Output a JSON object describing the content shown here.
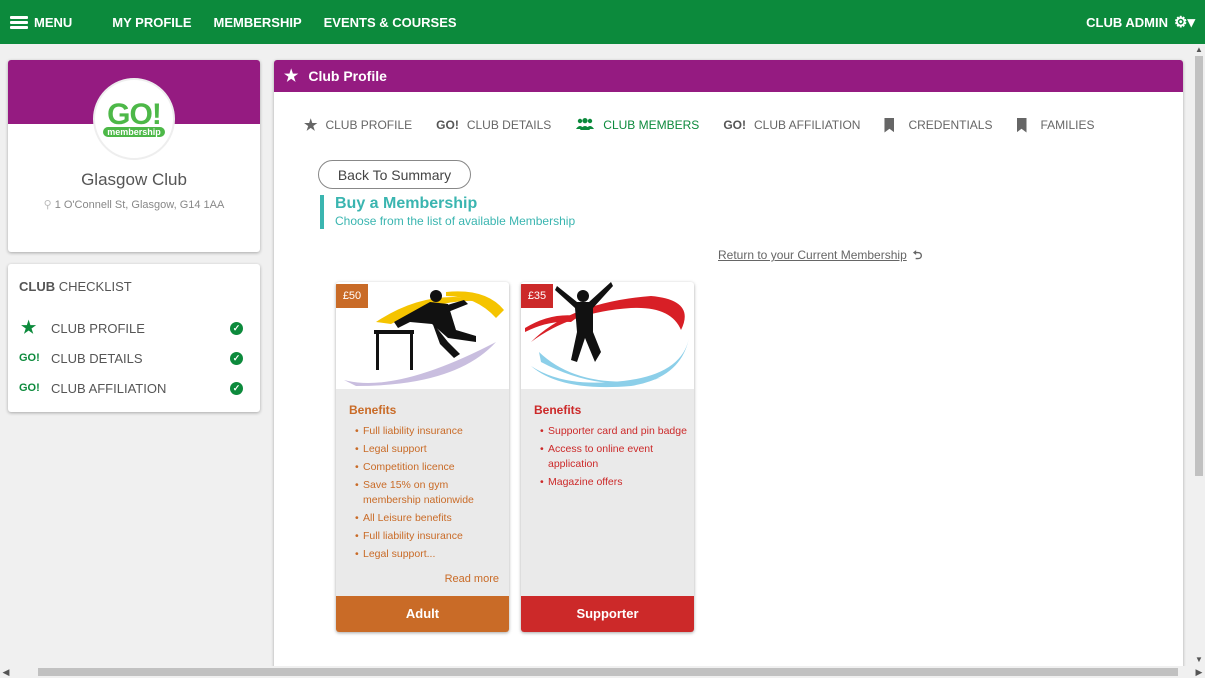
{
  "colors": {
    "brand_green": "#0c8a3c",
    "purple": "#951b81",
    "teal": "#3ab5b0",
    "adult_orange": "#c96b27",
    "supporter_red": "#cc2929"
  },
  "topbar": {
    "menu_label": "MENU",
    "nav": [
      "MY PROFILE",
      "MEMBERSHIP",
      "EVENTS & COURSES"
    ],
    "admin_label": "CLUB ADMIN"
  },
  "club": {
    "logo_text": "GO!",
    "logo_sub": "membership",
    "name": "Glasgow Club",
    "address": "1 O'Connell St, Glasgow, G14 1AA"
  },
  "checklist": {
    "title_bold": "CLUB",
    "title_rest": " CHECKLIST",
    "items": [
      {
        "icon": "star-icon",
        "prefix": "",
        "label": "CLUB PROFILE"
      },
      {
        "icon": "go-icon",
        "prefix": "GO!",
        "label": "CLUB DETAILS"
      },
      {
        "icon": "go-icon",
        "prefix": "GO!",
        "label": "CLUB AFFILIATION"
      }
    ]
  },
  "panel": {
    "title": "Club Profile",
    "tabs": [
      {
        "prefix": "",
        "label": "CLUB PROFILE"
      },
      {
        "prefix": "GO!",
        "label": "CLUB DETAILS"
      },
      {
        "prefix": "",
        "label": "CLUB MEMBERS",
        "active": true
      },
      {
        "prefix": "GO!",
        "label": "CLUB AFFILIATION"
      },
      {
        "prefix": "",
        "label": "CREDENTIALS"
      },
      {
        "prefix": "",
        "label": "FAMILIES"
      }
    ],
    "back_label": "Back To Summary",
    "buy_title": "Buy a Membership",
    "buy_subtitle": "Choose from the list of available Membership",
    "return_label": "Return to your Current Membership"
  },
  "cards": [
    {
      "price": "£50",
      "benefits_title": "Benefits",
      "benefits": [
        "Full liability insurance",
        "Legal support",
        "Competition licence",
        "Save 15% on gym membership nationwide",
        "All Leisure benefits",
        "Full liability insurance",
        "Legal support..."
      ],
      "read_more": "Read more",
      "name": "Adult"
    },
    {
      "price": "£35",
      "benefits_title": "Benefits",
      "benefits": [
        "Supporter card and pin badge",
        "Access to online event application",
        "Magazine offers"
      ],
      "name": "Supporter"
    }
  ]
}
